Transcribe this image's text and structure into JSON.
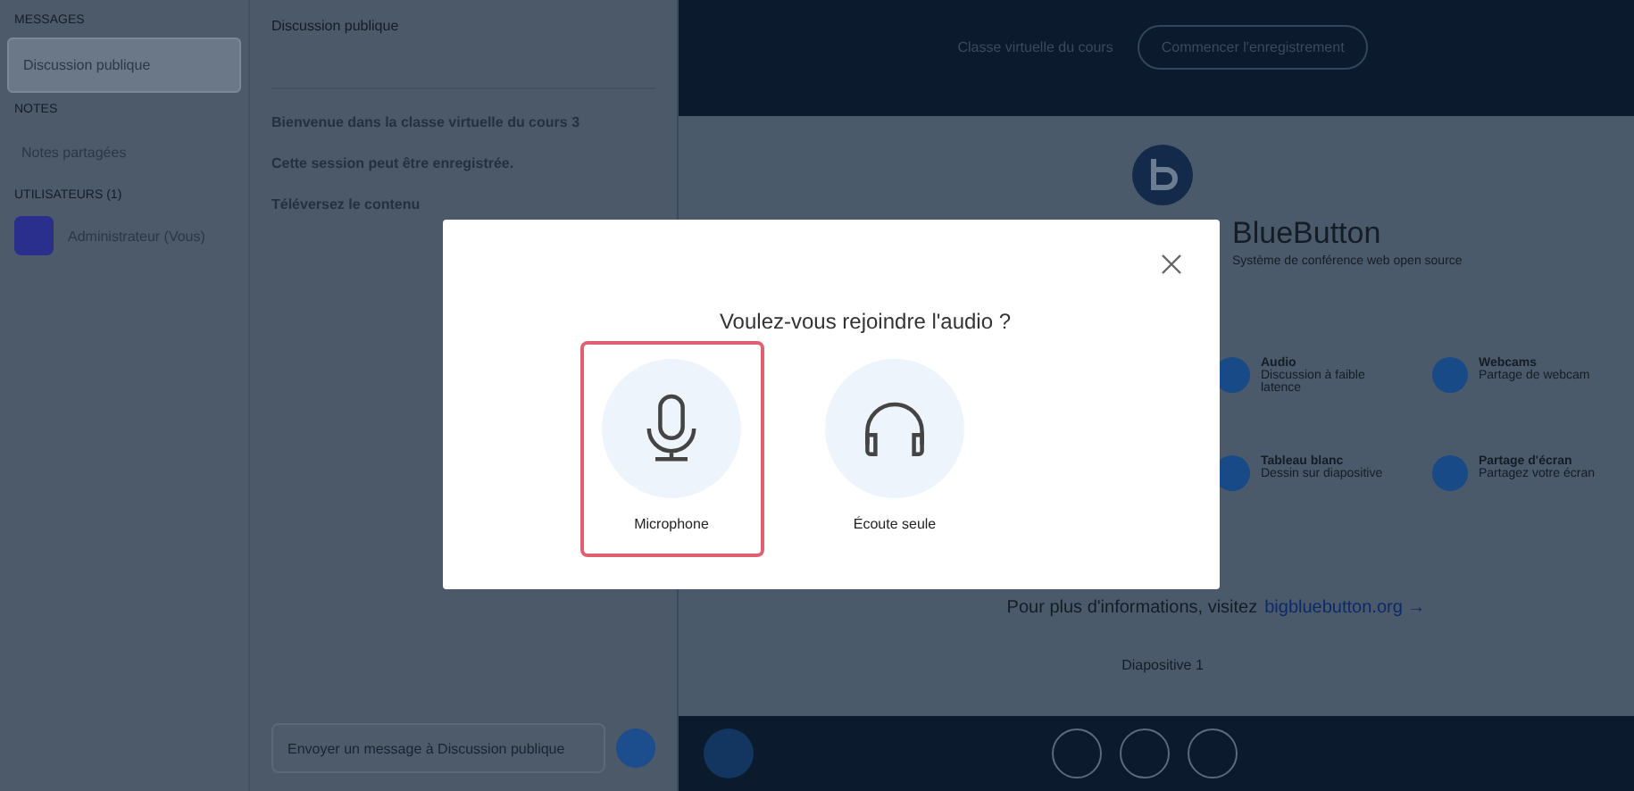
{
  "sidebar": {
    "messages_heading": "MESSAGES",
    "messages": [
      {
        "label": "Discussion publique",
        "selected": true
      }
    ],
    "notes_heading": "NOTES",
    "notes": [
      {
        "label": "Notes partagées",
        "selected": false
      }
    ],
    "users_heading": "UTILISATEURS (1)",
    "users": [
      {
        "name": "Administrateur (Vous)",
        "color": "#2a2e8c"
      }
    ]
  },
  "chat": {
    "title": "Discussion publique",
    "messages": [
      "Bienvenue dans la classe virtuelle du cours 3",
      "Cette session peut être enregistrée.",
      "Téléversez le contenu"
    ],
    "input": {
      "placeholder": "Envoyer un message à Discussion publique"
    }
  },
  "navbar": {
    "title": "Classe virtuelle du cours",
    "recording": "Commencer l'enregistrement"
  },
  "presentation": {
    "title": "BlueButton",
    "subtitle": "Système de conférence web open source",
    "features": [
      {
        "title": "Audio",
        "text": "Discussion à faible latence"
      },
      {
        "title": "Webcams",
        "text": "Partage de webcam"
      },
      {
        "title": "Tableau blanc",
        "text": "Dessin sur diapositive"
      },
      {
        "title": "Partage d'écran",
        "text": "Partagez votre écran"
      }
    ],
    "link_text": "Pour plus d'informations, visitez",
    "link": "bigbluebutton.org →",
    "slide": "Diapositive 1"
  },
  "modal": {
    "title": "Voulez-vous rejoindre l'audio ?",
    "options": [
      {
        "kind": "microphone",
        "label": "Microphone",
        "selected": true
      },
      {
        "kind": "listen",
        "label": "Écoute seule",
        "selected": false
      }
    ]
  }
}
